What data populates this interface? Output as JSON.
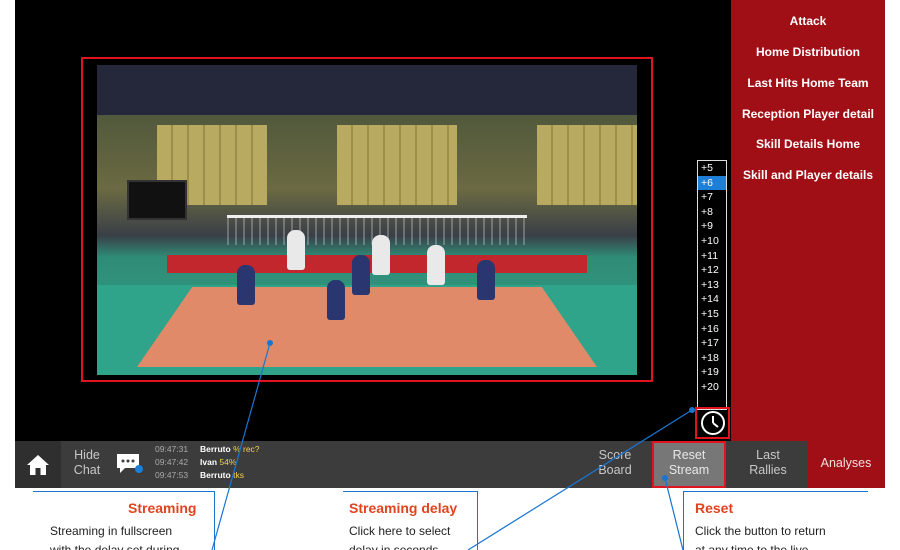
{
  "sidebar": {
    "items": [
      {
        "label": "Attack"
      },
      {
        "label": "Home Distribution"
      },
      {
        "label": "Last Hits Home Team"
      },
      {
        "label": "Reception Player detail"
      },
      {
        "label": "Skill Details Home"
      },
      {
        "label": "Skill and Player details"
      }
    ]
  },
  "delay": {
    "options": [
      "+5",
      "+6",
      "+7",
      "+8",
      "+9",
      "+10",
      "+11",
      "+12",
      "+13",
      "+14",
      "+15",
      "+16",
      "+17",
      "+18",
      "+19",
      "+20"
    ],
    "selected": "+6"
  },
  "bottom": {
    "hide_chat": [
      "Hide",
      "Chat"
    ],
    "messages": [
      {
        "time": "09:47:31",
        "user": "Berruto",
        "text": "% rec?"
      },
      {
        "time": "09:47:42",
        "user": "Ivan",
        "text": "54%"
      },
      {
        "time": "09:47:53",
        "user": "Berruto",
        "text": "tks"
      }
    ],
    "score_board": [
      "Score",
      "Board"
    ],
    "reset_stream": [
      "Reset",
      "Stream"
    ],
    "last_rallies": [
      "Last",
      "Rallies"
    ],
    "analyses": "Analyses"
  },
  "annotations": {
    "streaming": {
      "title": "Streaming",
      "lines": [
        "Streaming in  fullscreen",
        "with the delay set during"
      ]
    },
    "streaming_delay": {
      "title": "Streaming delay",
      "lines": [
        "Click here to select",
        "delay in seconds"
      ]
    },
    "reset": {
      "title": "Reset",
      "lines": [
        "Click the button to return",
        "at any time to the live"
      ]
    }
  },
  "colors": {
    "sidebar": "#a10f16",
    "highlight": "#e0141e",
    "selected_delay": "#1e7fd6",
    "callout_title": "#e2431d",
    "callout_line": "#1a75d2"
  }
}
